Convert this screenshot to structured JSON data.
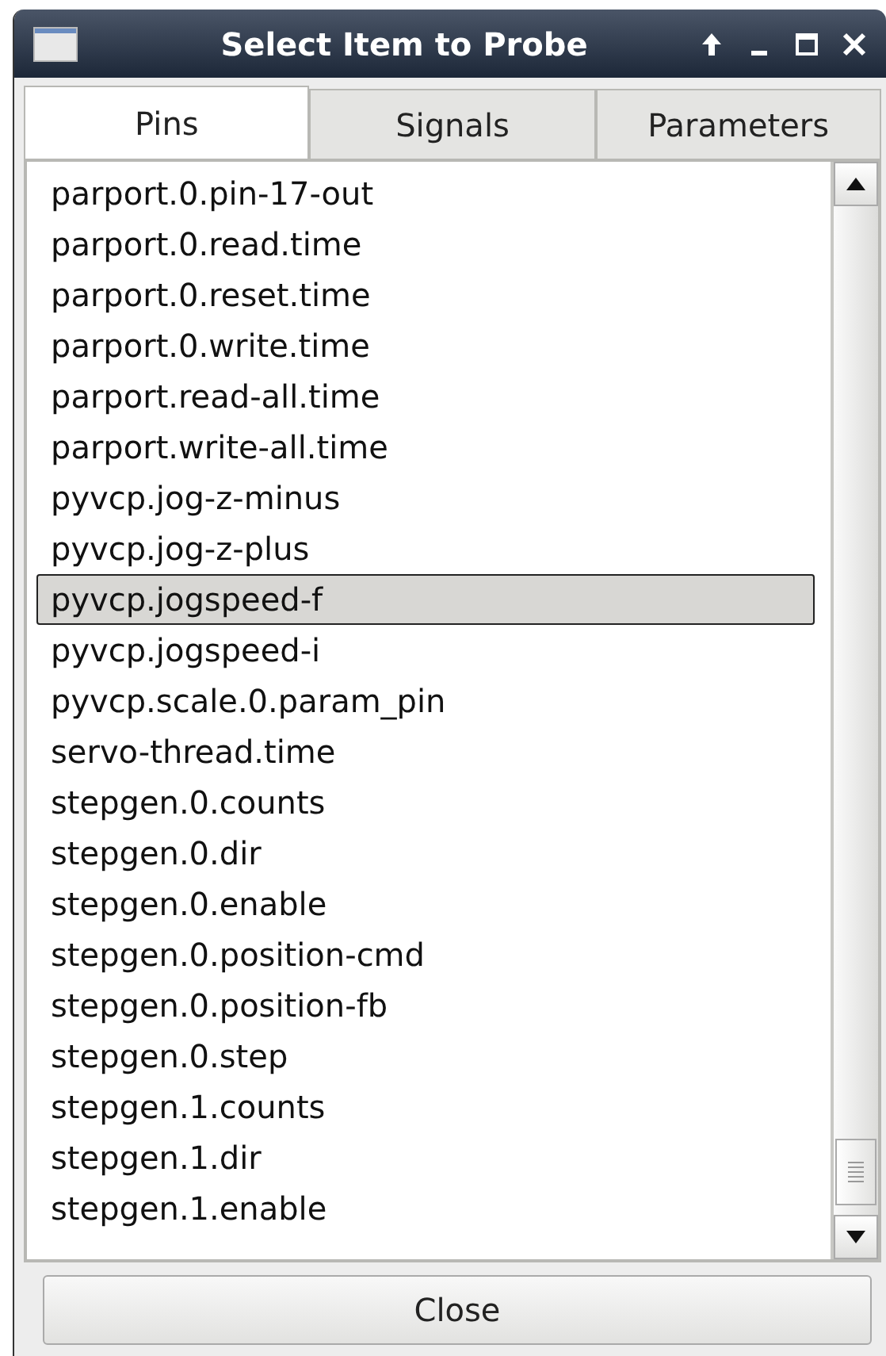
{
  "window": {
    "title": "Select Item to Probe"
  },
  "tabs": [
    {
      "label": "Pins",
      "selected": true
    },
    {
      "label": "Signals",
      "selected": false
    },
    {
      "label": "Parameters",
      "selected": false
    }
  ],
  "items": [
    {
      "label": "parport.0.pin-17-out",
      "selected": false
    },
    {
      "label": "parport.0.read.time",
      "selected": false
    },
    {
      "label": "parport.0.reset.time",
      "selected": false
    },
    {
      "label": "parport.0.write.time",
      "selected": false
    },
    {
      "label": "parport.read-all.time",
      "selected": false
    },
    {
      "label": "parport.write-all.time",
      "selected": false
    },
    {
      "label": "pyvcp.jog-z-minus",
      "selected": false
    },
    {
      "label": "pyvcp.jog-z-plus",
      "selected": false
    },
    {
      "label": "pyvcp.jogspeed-f",
      "selected": true
    },
    {
      "label": "pyvcp.jogspeed-i",
      "selected": false
    },
    {
      "label": "pyvcp.scale.0.param_pin",
      "selected": false
    },
    {
      "label": "servo-thread.time",
      "selected": false
    },
    {
      "label": "stepgen.0.counts",
      "selected": false
    },
    {
      "label": "stepgen.0.dir",
      "selected": false
    },
    {
      "label": "stepgen.0.enable",
      "selected": false
    },
    {
      "label": "stepgen.0.position-cmd",
      "selected": false
    },
    {
      "label": "stepgen.0.position-fb",
      "selected": false
    },
    {
      "label": "stepgen.0.step",
      "selected": false
    },
    {
      "label": "stepgen.1.counts",
      "selected": false
    },
    {
      "label": "stepgen.1.dir",
      "selected": false
    },
    {
      "label": "stepgen.1.enable",
      "selected": false
    }
  ],
  "buttons": [
    {
      "label": "Close"
    }
  ]
}
